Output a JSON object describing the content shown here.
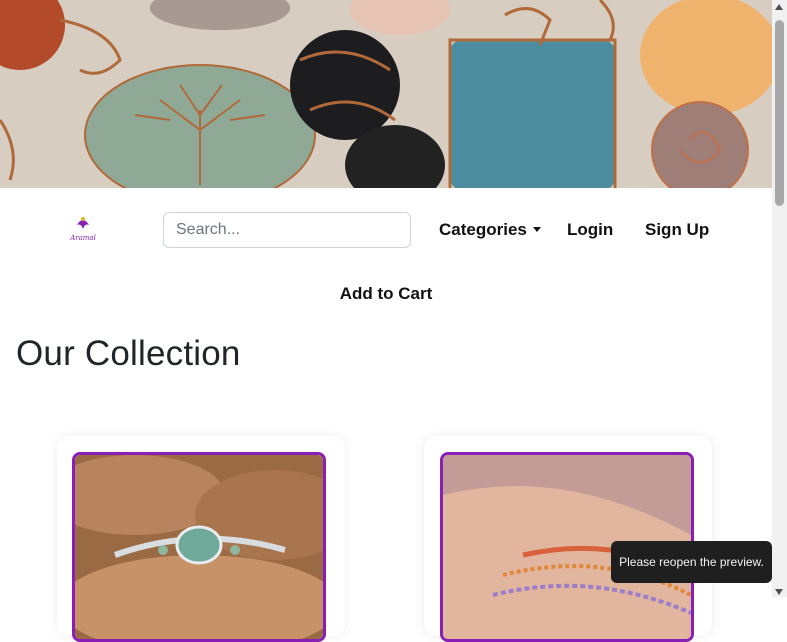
{
  "header": {
    "hero_image": "copper-wire-wrapped-gemstones-photo",
    "logo_text": "Aramal",
    "search_placeholder": "Search...",
    "nav": {
      "categories": "Categories",
      "login": "Login",
      "signup": "Sign Up"
    },
    "add_to_cart": "Add to Cart"
  },
  "main": {
    "title": "Our Collection",
    "products": [
      {
        "image": "moss-agate-ring-photo"
      },
      {
        "image": "beaded-bracelets-on-wrist-photo"
      }
    ]
  },
  "toast": {
    "message": "Please reopen the preview."
  },
  "colors": {
    "accent": "#8a1fb5",
    "text": "#212529",
    "toast_bg": "#1f1f1f"
  }
}
